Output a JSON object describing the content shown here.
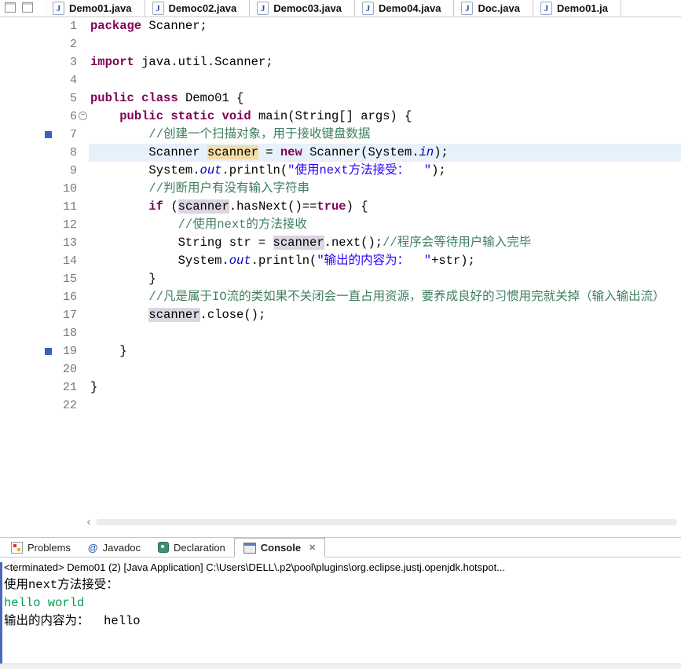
{
  "icons": {
    "java_file_glyph": "J",
    "javadoc_glyph": "@",
    "close_glyph": "✕",
    "scroll_left_glyph": "‹",
    "fold_collapse_glyph": "−"
  },
  "editor_tabs": [
    {
      "label": "Demo01.java",
      "selected": true
    },
    {
      "label": "Democ02.java",
      "selected": false
    },
    {
      "label": "Democ03.java",
      "selected": false
    },
    {
      "label": "Demo04.java",
      "selected": false
    },
    {
      "label": "Doc.java",
      "selected": false
    },
    {
      "label": "Demo01.ja",
      "selected": false
    }
  ],
  "editor": {
    "lines": [
      {
        "num": "1",
        "tokens": [
          [
            "kw",
            "package"
          ],
          [
            "plain",
            " Scanner;"
          ]
        ]
      },
      {
        "num": "2",
        "tokens": []
      },
      {
        "num": "3",
        "tokens": [
          [
            "kw",
            "import"
          ],
          [
            "plain",
            " java.util.Scanner;"
          ]
        ]
      },
      {
        "num": "4",
        "tokens": []
      },
      {
        "num": "5",
        "tokens": [
          [
            "kw",
            "public"
          ],
          [
            "plain",
            " "
          ],
          [
            "kw",
            "class"
          ],
          [
            "plain",
            " Demo01 {"
          ]
        ]
      },
      {
        "num": "6",
        "fold": true,
        "tokens": [
          [
            "plain",
            "    "
          ],
          [
            "kw",
            "public"
          ],
          [
            "plain",
            " "
          ],
          [
            "kw",
            "static"
          ],
          [
            "plain",
            " "
          ],
          [
            "kw",
            "void"
          ],
          [
            "plain",
            " main(String[] args) {"
          ]
        ]
      },
      {
        "num": "7",
        "marker": true,
        "tokens": [
          [
            "plain",
            "        "
          ],
          [
            "com",
            "//创建一个扫描对象，用于接收键盘数据"
          ]
        ]
      },
      {
        "num": "8",
        "current": true,
        "tokens": [
          [
            "plain",
            "        Scanner "
          ],
          [
            "occw",
            "scanner"
          ],
          [
            "plain",
            " = "
          ],
          [
            "kw",
            "new"
          ],
          [
            "plain",
            " Scanner(System."
          ],
          [
            "field",
            "in"
          ],
          [
            "plain",
            ");"
          ]
        ]
      },
      {
        "num": "9",
        "tokens": [
          [
            "plain",
            "        System."
          ],
          [
            "field",
            "out"
          ],
          [
            "plain",
            ".println("
          ],
          [
            "str",
            "\"使用next方法接受：  \""
          ],
          [
            "plain",
            ");"
          ]
        ]
      },
      {
        "num": "10",
        "tokens": [
          [
            "plain",
            "        "
          ],
          [
            "com",
            "//判断用户有没有输入字符串"
          ]
        ]
      },
      {
        "num": "11",
        "tokens": [
          [
            "plain",
            "        "
          ],
          [
            "kw",
            "if"
          ],
          [
            "plain",
            " ("
          ],
          [
            "occ",
            "scanner"
          ],
          [
            "plain",
            ".hasNext()=="
          ],
          [
            "kw",
            "true"
          ],
          [
            "plain",
            ") {"
          ]
        ]
      },
      {
        "num": "12",
        "tokens": [
          [
            "plain",
            "            "
          ],
          [
            "com",
            "//使用next的方法接收"
          ]
        ]
      },
      {
        "num": "13",
        "tokens": [
          [
            "plain",
            "            String str = "
          ],
          [
            "occ",
            "scanner"
          ],
          [
            "plain",
            ".next();"
          ],
          [
            "com",
            "//程序会等待用户输入完毕"
          ]
        ]
      },
      {
        "num": "14",
        "tokens": [
          [
            "plain",
            "            System."
          ],
          [
            "field",
            "out"
          ],
          [
            "plain",
            ".println("
          ],
          [
            "str",
            "\"输出的内容为：  \""
          ],
          [
            "plain",
            "+str);"
          ]
        ]
      },
      {
        "num": "15",
        "tokens": [
          [
            "plain",
            "        }"
          ]
        ]
      },
      {
        "num": "16",
        "tokens": [
          [
            "plain",
            "        "
          ],
          [
            "com",
            "//凡是属于IO流的类如果不关闭会一直占用资源，要养成良好的习惯用完就关掉（输入输出流）"
          ]
        ]
      },
      {
        "num": "17",
        "tokens": [
          [
            "plain",
            "        "
          ],
          [
            "occ",
            "scanner"
          ],
          [
            "plain",
            ".close();"
          ]
        ]
      },
      {
        "num": "18",
        "tokens": []
      },
      {
        "num": "19",
        "marker": true,
        "tokens": [
          [
            "plain",
            "    }"
          ]
        ]
      },
      {
        "num": "20",
        "tokens": []
      },
      {
        "num": "21",
        "tokens": [
          [
            "plain",
            "}"
          ]
        ]
      },
      {
        "num": "22",
        "tokens": []
      }
    ]
  },
  "bottom_tabs": [
    {
      "label": "Problems",
      "icon": "problems",
      "selected": false,
      "closable": false
    },
    {
      "label": "Javadoc",
      "icon": "javadoc",
      "selected": false,
      "closable": false
    },
    {
      "label": "Declaration",
      "icon": "declaration",
      "selected": false,
      "closable": false
    },
    {
      "label": "Console",
      "icon": "console",
      "selected": true,
      "closable": true
    }
  ],
  "console": {
    "status_line": "<terminated> Demo01 (2) [Java Application] C:\\Users\\DELL\\.p2\\pool\\plugins\\org.eclipse.justj.openjdk.hotspot...",
    "output": [
      {
        "text": "使用next方法接受：",
        "kind": "stdout"
      },
      {
        "text": "hello world",
        "kind": "stdin"
      },
      {
        "text": "输出的内容为：  hello",
        "kind": "stdout"
      }
    ]
  },
  "colors": {
    "keyword": "#7f0055",
    "string": "#2a00ff",
    "comment": "#3f7f5f",
    "field": "#0000c0",
    "current_line_bg": "#e7f1fb",
    "occurrence_bg": "#dad5e1",
    "write_occurrence_bg": "#f2dda6",
    "stdin_green": "#00a050"
  }
}
